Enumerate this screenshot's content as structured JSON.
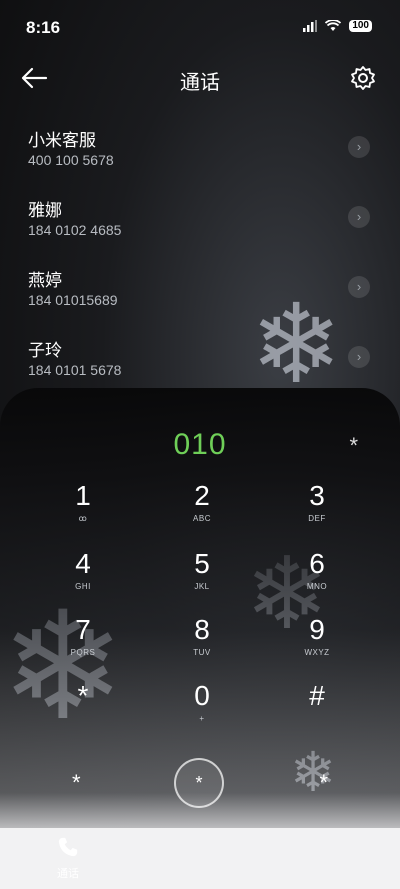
{
  "status": {
    "time": "8:16",
    "battery": "100"
  },
  "header": {
    "title": "通话"
  },
  "contacts": [
    {
      "name": "小米客服",
      "number": "400 100 5678"
    },
    {
      "name": "雅娜",
      "number": "184 0102 4685"
    },
    {
      "name": "燕婷",
      "number": "184 01015689"
    },
    {
      "name": "子玲",
      "number": "184 0101 5678"
    }
  ],
  "dialpad": {
    "display": "010",
    "display_star": "*",
    "keys": [
      {
        "digit": "1",
        "letters": "ꝏ"
      },
      {
        "digit": "2",
        "letters": "ABC"
      },
      {
        "digit": "3",
        "letters": "DEF"
      },
      {
        "digit": "4",
        "letters": "GHI"
      },
      {
        "digit": "5",
        "letters": "JKL"
      },
      {
        "digit": "6",
        "letters": "MNO"
      },
      {
        "digit": "7",
        "letters": "PQRS"
      },
      {
        "digit": "8",
        "letters": "TUV"
      },
      {
        "digit": "9",
        "letters": "WXYZ"
      },
      {
        "digit": "*",
        "letters": ""
      },
      {
        "digit": "0",
        "letters": "+"
      },
      {
        "digit": "#",
        "letters": ""
      }
    ],
    "bottom_left": "*",
    "call_symbol": "*",
    "bottom_right": "*"
  },
  "tabs": [
    {
      "label": "通话",
      "icon": "phone-icon"
    },
    {
      "label": "",
      "icon": "contacts-icon"
    },
    {
      "label": "",
      "icon": "more-icon"
    }
  ]
}
